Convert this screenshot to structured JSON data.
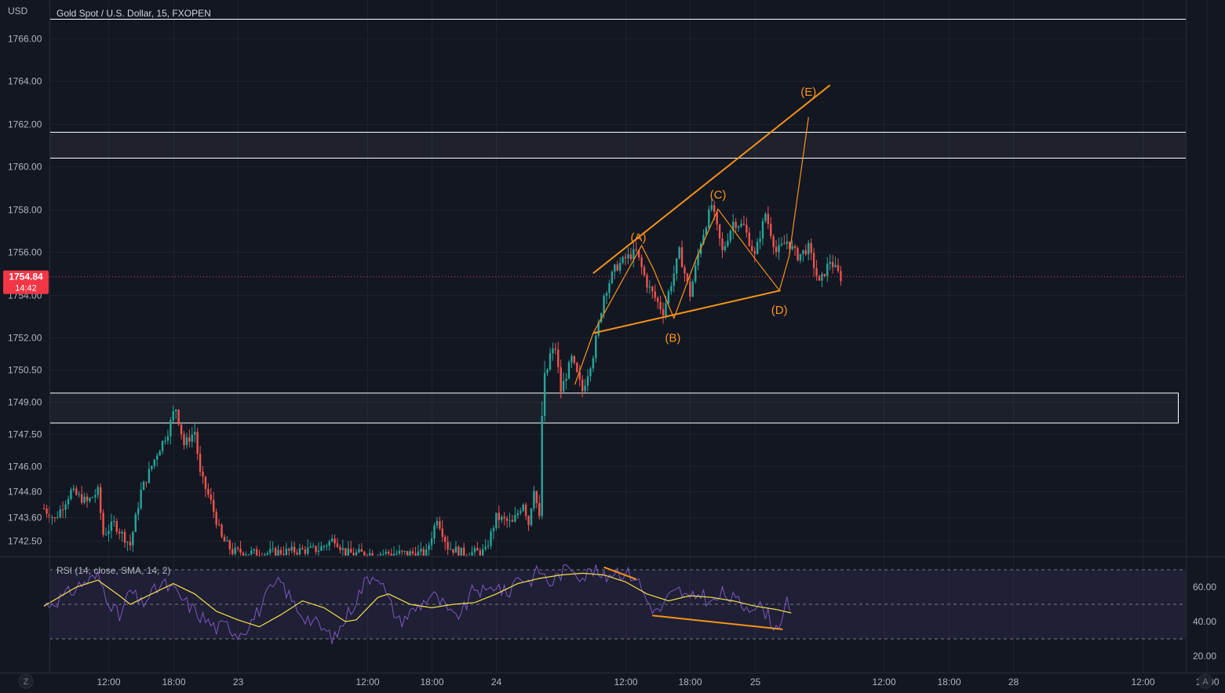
{
  "header": {
    "currency": "USD",
    "symbol_title": "Gold Spot / U.S. Dollar, 15, FXOPEN"
  },
  "last_price": {
    "value": "1754.84",
    "countdown": "14:42",
    "price": 1754.84,
    "color": "#f23645"
  },
  "colors": {
    "background": "#131722",
    "grid": "#1e222d",
    "up": "#26a69a",
    "down": "#ef5350",
    "pattern": "#f7931a",
    "zone_line": "#ffffff",
    "rsi_line": "#7e57c2",
    "rsi_sma": "#f5e04a",
    "rsi_band": "#7e57c2"
  },
  "buttons": {
    "zoom_label": "Z",
    "auto_label": "A"
  },
  "chart_data": [
    {
      "type": "candlestick",
      "title": "Gold Spot / U.S. Dollar, 15, FXOPEN",
      "ylabel": "USD",
      "ylim": [
        1741.8,
        1767.0
      ],
      "y_ticks": [
        "1766.00",
        "1764.00",
        "1762.00",
        "1760.00",
        "1758.00",
        "1756.00",
        "1754.00",
        "1752.00",
        "1750.50",
        "1749.00",
        "1747.50",
        "1746.00",
        "1744.80",
        "1743.60",
        "1742.50"
      ],
      "y_tick_values": [
        1766,
        1764,
        1762,
        1760,
        1758,
        1756,
        1754,
        1752,
        1750.5,
        1749,
        1747.5,
        1746,
        1744.8,
        1743.6,
        1742.5
      ],
      "x_ticks": [
        "12:00",
        "18:00",
        "23",
        "12:00",
        "18:00",
        "24",
        "12:00",
        "18:00",
        "25",
        "12:00",
        "18:00",
        "28",
        "12:00",
        "18:00"
      ],
      "x_tick_hours": [
        12,
        18,
        24,
        36,
        42,
        48,
        60,
        66,
        72,
        84,
        90,
        96,
        108,
        114
      ],
      "x_start_hour": 6,
      "horizontal_levels": [
        1766.9,
        1761.6,
        1760.4
      ],
      "zone": {
        "top": 1749.4,
        "bottom": 1748.0
      },
      "candles_anchor_path": [
        [
          6.0,
          1744
        ],
        [
          7.0,
          1743.5
        ],
        [
          8.5,
          1744.8
        ],
        [
          10.0,
          1744.3
        ],
        [
          11.0,
          1744.8
        ],
        [
          11.5,
          1742.8
        ],
        [
          12.5,
          1743.3
        ],
        [
          14.0,
          1742.3
        ],
        [
          15.0,
          1744.8
        ],
        [
          16.5,
          1746.6
        ],
        [
          17.5,
          1747.6
        ],
        [
          18.2,
          1748.8
        ],
        [
          19.0,
          1747.0
        ],
        [
          20.0,
          1747.6
        ],
        [
          20.5,
          1745.6
        ],
        [
          21.5,
          1744.3
        ],
        [
          22.5,
          1742.6
        ],
        [
          23.5,
          1742.0
        ],
        [
          26.0,
          1741.9
        ],
        [
          31.5,
          1742.1
        ],
        [
          33.0,
          1742.6
        ],
        [
          34.0,
          1741.9
        ],
        [
          41.5,
          1741.9
        ],
        [
          42.5,
          1743.6
        ],
        [
          43.5,
          1742.2
        ],
        [
          45.0,
          1741.9
        ],
        [
          47.0,
          1742.0
        ],
        [
          48.0,
          1743.6
        ],
        [
          49.5,
          1743.3
        ],
        [
          50.5,
          1744.3
        ],
        [
          51.0,
          1743.3
        ],
        [
          51.5,
          1745.0
        ],
        [
          52.0,
          1743.5
        ],
        [
          52.3,
          1749.3
        ],
        [
          53.0,
          1751.2
        ],
        [
          53.5,
          1751.5
        ],
        [
          54.0,
          1749.5
        ],
        [
          55.0,
          1751.0
        ],
        [
          56.0,
          1749.5
        ],
        [
          57.0,
          1751.2
        ],
        [
          58.0,
          1754.0
        ],
        [
          59.0,
          1755.2
        ],
        [
          60.0,
          1755.7
        ],
        [
          61.0,
          1756.0
        ],
        [
          62.0,
          1754.5
        ],
        [
          63.5,
          1753.2
        ],
        [
          64.5,
          1755.0
        ],
        [
          65.0,
          1756.0
        ],
        [
          66.0,
          1754.0
        ],
        [
          67.0,
          1756.5
        ],
        [
          68.0,
          1758.2
        ],
        [
          69.0,
          1756.0
        ],
        [
          70.0,
          1757.4
        ],
        [
          71.0,
          1757.2
        ],
        [
          72.0,
          1755.8
        ],
        [
          73.0,
          1757.8
        ],
        [
          74.0,
          1756.0
        ],
        [
          75.0,
          1756.5
        ],
        [
          76.0,
          1755.8
        ],
        [
          77.0,
          1756.2
        ],
        [
          78.0,
          1754.5
        ],
        [
          79.0,
          1755.6
        ],
        [
          80.0,
          1754.8
        ]
      ],
      "wave_labels": [
        {
          "text": "(A)",
          "x_hour": 61.2,
          "price": 1756.5
        },
        {
          "text": "(B)",
          "x_hour": 64.4,
          "price": 1751.8
        },
        {
          "text": "(C)",
          "x_hour": 68.6,
          "price": 1758.5
        },
        {
          "text": "(D)",
          "x_hour": 74.3,
          "price": 1753.1
        },
        {
          "text": "(E)",
          "x_hour": 77.0,
          "price": 1763.3
        }
      ],
      "trendlines": [
        {
          "from": [
            57.0,
            1755.0
          ],
          "to": [
            79.0,
            1763.8
          ]
        },
        {
          "from": [
            57.0,
            1752.2
          ],
          "to": [
            74.4,
            1754.2
          ]
        }
      ],
      "wave_path": [
        [
          55.3,
          1749.8
        ],
        [
          57.0,
          1752.2
        ],
        [
          61.5,
          1756.3
        ],
        [
          62.6,
          1755.2
        ],
        [
          64.5,
          1752.9
        ],
        [
          66.5,
          1755.6
        ],
        [
          68.6,
          1758.0
        ],
        [
          72.0,
          1755.7
        ],
        [
          74.3,
          1754.2
        ],
        [
          75.2,
          1755.8
        ],
        [
          77.0,
          1762.3
        ]
      ]
    },
    {
      "type": "line",
      "title": "RSI (14, close, SMA, 14, 2)",
      "ylim": [
        15,
        75
      ],
      "y_ticks": [
        "60.00",
        "40.00",
        "20.00"
      ],
      "y_tick_values": [
        60,
        40,
        20
      ],
      "bands": [
        70,
        30
      ],
      "midline": 50,
      "rsi_anchor_path": [
        [
          6,
          49
        ],
        [
          8,
          55
        ],
        [
          9.5,
          62
        ],
        [
          11,
          66
        ],
        [
          12,
          53
        ],
        [
          13,
          42
        ],
        [
          14,
          58
        ],
        [
          15,
          50
        ],
        [
          16,
          56
        ],
        [
          17,
          62
        ],
        [
          18,
          58
        ],
        [
          19,
          52
        ],
        [
          20,
          46
        ],
        [
          21,
          41
        ],
        [
          22,
          36
        ],
        [
          23,
          38
        ],
        [
          24,
          33
        ],
        [
          25,
          38
        ],
        [
          26,
          47
        ],
        [
          27,
          58
        ],
        [
          28,
          63
        ],
        [
          29,
          52
        ],
        [
          30,
          44
        ],
        [
          31,
          40
        ],
        [
          32,
          35
        ],
        [
          33,
          30
        ],
        [
          34,
          42
        ],
        [
          35,
          53
        ],
        [
          36,
          65
        ],
        [
          37,
          68
        ],
        [
          38,
          52
        ],
        [
          39,
          40
        ],
        [
          40,
          45
        ],
        [
          41,
          50
        ],
        [
          42,
          56
        ],
        [
          43,
          50
        ],
        [
          44,
          42
        ],
        [
          45,
          47
        ],
        [
          46,
          60
        ],
        [
          47,
          56
        ],
        [
          48,
          62
        ],
        [
          49,
          55
        ],
        [
          50,
          67
        ],
        [
          51,
          63
        ],
        [
          52,
          70
        ],
        [
          53,
          62
        ],
        [
          54,
          68
        ],
        [
          55,
          72
        ],
        [
          56,
          66
        ],
        [
          57,
          70
        ],
        [
          58,
          65
        ],
        [
          59,
          70
        ],
        [
          60,
          68
        ],
        [
          61,
          66
        ],
        [
          62,
          52
        ],
        [
          63,
          45
        ],
        [
          64,
          54
        ],
        [
          65,
          58
        ],
        [
          66,
          52
        ],
        [
          67,
          57
        ],
        [
          68,
          50
        ],
        [
          69,
          56
        ],
        [
          70,
          53
        ],
        [
          71,
          49
        ],
        [
          72,
          50
        ],
        [
          73,
          46
        ],
        [
          74,
          36
        ],
        [
          75,
          50
        ],
        [
          75.4,
          42
        ]
      ],
      "sma_anchor_path": [
        [
          6,
          49
        ],
        [
          9,
          60
        ],
        [
          11,
          64
        ],
        [
          13,
          55
        ],
        [
          14,
          50
        ],
        [
          16,
          56
        ],
        [
          18,
          62
        ],
        [
          20,
          56
        ],
        [
          22,
          46
        ],
        [
          24,
          41
        ],
        [
          26,
          37
        ],
        [
          28,
          44
        ],
        [
          30,
          52
        ],
        [
          32,
          48
        ],
        [
          34,
          40
        ],
        [
          35,
          41
        ],
        [
          37,
          54
        ],
        [
          38,
          56
        ],
        [
          40,
          50
        ],
        [
          42,
          48
        ],
        [
          44,
          50
        ],
        [
          46,
          51
        ],
        [
          48,
          56
        ],
        [
          50,
          62
        ],
        [
          52,
          65
        ],
        [
          54,
          67
        ],
        [
          56,
          68
        ],
        [
          58,
          67
        ],
        [
          60,
          63
        ],
        [
          62,
          56
        ],
        [
          64,
          52
        ],
        [
          66,
          55
        ],
        [
          68,
          54
        ],
        [
          70,
          52
        ],
        [
          72,
          49
        ],
        [
          74,
          47
        ],
        [
          75.4,
          45
        ]
      ],
      "divergence_lines": [
        {
          "from": [
            58.0,
            71.5
          ],
          "to": [
            61.0,
            64.5
          ]
        },
        {
          "from": [
            62.5,
            43.5
          ],
          "to": [
            74.6,
            35.5
          ]
        }
      ]
    }
  ]
}
